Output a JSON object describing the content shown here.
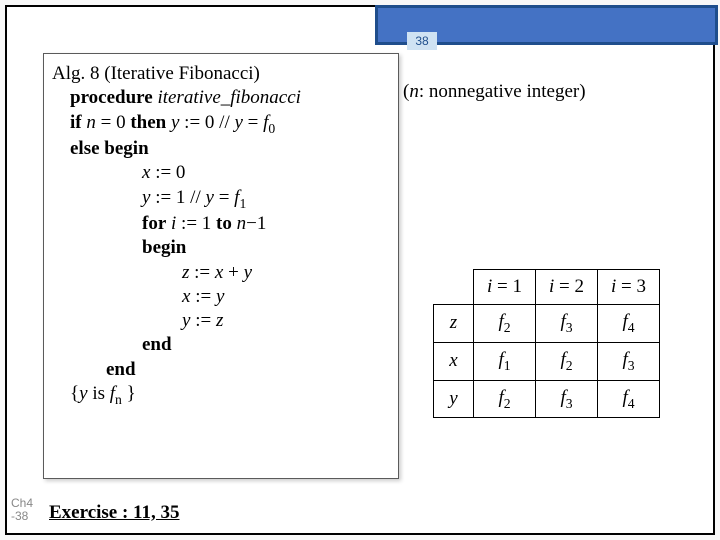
{
  "page_number": "38",
  "ch_tag_top": "Ch4",
  "ch_tag_bot": "-38",
  "alg": {
    "title": "Alg. 8 (Iterative Fibonacci)",
    "proc_kw": "procedure",
    "proc_name": "iterative_fibonacci",
    "proc_args_prefix": " (",
    "proc_arg_var": "n",
    "proc_args_suffix": ": nonnegative integer)",
    "if_kw": "if",
    "if_cond_var": "n",
    "if_cond_rest": " = 0 ",
    "then_kw": "then",
    "then_body_a": " y",
    "then_body_b": " := 0     // ",
    "then_body_c": "y",
    "then_body_d": " = ",
    "then_body_e": "f",
    "then_body_sub": "0",
    "else_kw": "else begin",
    "x0_a": "x",
    "x0_b": " := 0",
    "y1_a": "y",
    "y1_b": " := 1    // ",
    "y1_c": "y",
    "y1_d": " = ",
    "y1_e": "f",
    "y1_sub": "1",
    "for_kw_a": "for",
    "for_var": " i",
    "for_mid": " := 1 ",
    "for_kw_b": "to",
    "for_end_a": " n",
    "for_end_b": "−1",
    "begin_kw": "begin",
    "z_a": "z",
    "z_b": " := ",
    "z_c": "x",
    "z_d": " + ",
    "z_e": "y",
    "xy_a": "x",
    "xy_b": " := ",
    "xy_c": "y",
    "yz_a": "y",
    "yz_b": " := ",
    "yz_c": "z",
    "end1": "end",
    "end2": "end",
    "post_a": "{",
    "post_b": "y",
    "post_c": " is ",
    "post_d": "f",
    "post_sub": "n",
    "post_e": " }"
  },
  "table": {
    "h_i": "i",
    "h1": " = 1",
    "h2": " = 2",
    "h3": " = 3",
    "row_z": "z",
    "row_x": "x",
    "row_y": "y",
    "f": "f",
    "s1": "1",
    "s2": "2",
    "s3": "3",
    "s4": "4"
  },
  "exercise": "Exercise : 11, 35"
}
